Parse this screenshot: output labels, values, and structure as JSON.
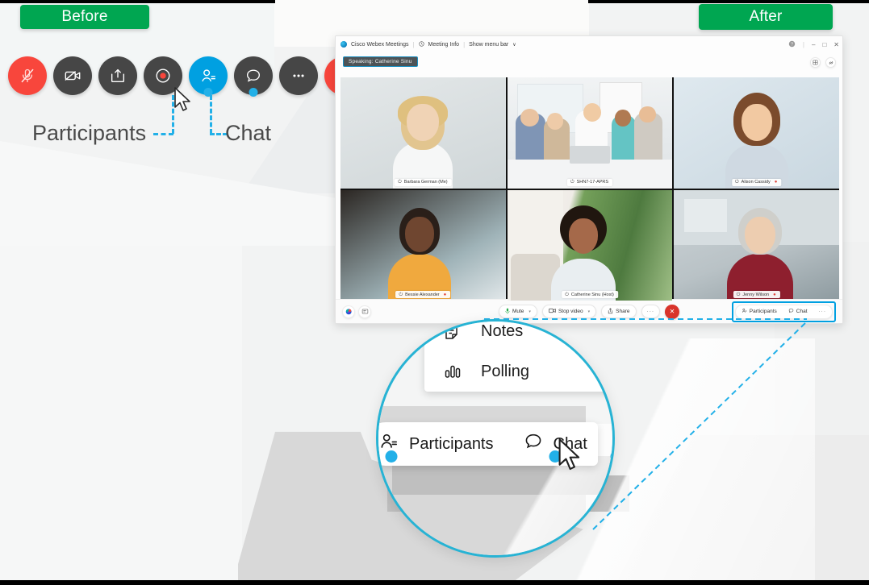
{
  "badges": {
    "before": "Before",
    "after": "After"
  },
  "before_toolbar": {
    "buttons": [
      {
        "name": "mute-audio-button",
        "icon": "microphone-muted-icon",
        "style": "red",
        "dot": false
      },
      {
        "name": "stop-video-button",
        "icon": "camera-off-icon",
        "style": "dark",
        "dot": false
      },
      {
        "name": "share-content-button",
        "icon": "share-up-icon",
        "style": "dark",
        "dot": false
      },
      {
        "name": "record-button",
        "icon": "record-circle-icon",
        "style": "dark",
        "dot": false
      },
      {
        "name": "participants-button",
        "icon": "participants-icon",
        "style": "blue",
        "dot": true
      },
      {
        "name": "chat-button",
        "icon": "chat-bubble-icon",
        "style": "dark",
        "dot": true
      },
      {
        "name": "more-options-button",
        "icon": "ellipsis-icon",
        "style": "dark",
        "dot": false
      },
      {
        "name": "leave-meeting-button",
        "icon": "close-x-icon",
        "style": "red",
        "dot": false
      }
    ],
    "labels": {
      "participants": "Participants",
      "chat": "Chat"
    }
  },
  "webex": {
    "titlebar": {
      "app_name": "Cisco Webex Meetings",
      "meeting_info": "Meeting Info",
      "show_menu_bar": "Show menu bar",
      "caret": "∨",
      "help": "?",
      "minimize": "–",
      "maximize": "□",
      "close": "✕"
    },
    "speaking_badge": "Speaking: Catherine Sinu",
    "top_right_icons": [
      {
        "name": "layout-grid-icon",
        "glyph": "▦"
      },
      {
        "name": "connect-device-icon",
        "glyph": "⚯"
      }
    ],
    "participants": [
      {
        "name": "Barbara German (Me)",
        "active": false,
        "recording": false
      },
      {
        "name": "SHN7-17-APRS",
        "active": false,
        "recording": false
      },
      {
        "name": "Alison Cassidy",
        "active": false,
        "recording": true
      },
      {
        "name": "Bessie Alexander",
        "active": false,
        "recording": true
      },
      {
        "name": "Catherine Sinu (Host)",
        "active": true,
        "recording": false
      },
      {
        "name": "Jenny Wilson",
        "active": false,
        "recording": true
      }
    ],
    "bottom_bar": {
      "left_icons": [
        {
          "name": "webex-assistant-icon"
        },
        {
          "name": "closed-captions-icon"
        }
      ],
      "mute": "Mute",
      "stop_video": "Stop video",
      "share": "Share",
      "more": "···",
      "end": "✕",
      "participants": "Participants",
      "chat": "Chat",
      "right_more": "···"
    }
  },
  "magnifier": {
    "menu_items": [
      {
        "label": "Notes",
        "icon": "notes-icon"
      },
      {
        "label": "Polling",
        "icon": "polling-bars-icon"
      }
    ],
    "toolbar": {
      "participants": "Participants",
      "chat": "Chat",
      "more": "vertical-ellipsis"
    }
  },
  "colors": {
    "green_badge": "#00a651",
    "accent_blue": "#00a0e1",
    "magnifier_ring": "#27b3d4",
    "red_button": "#f8463c",
    "dark_button": "#464646"
  }
}
